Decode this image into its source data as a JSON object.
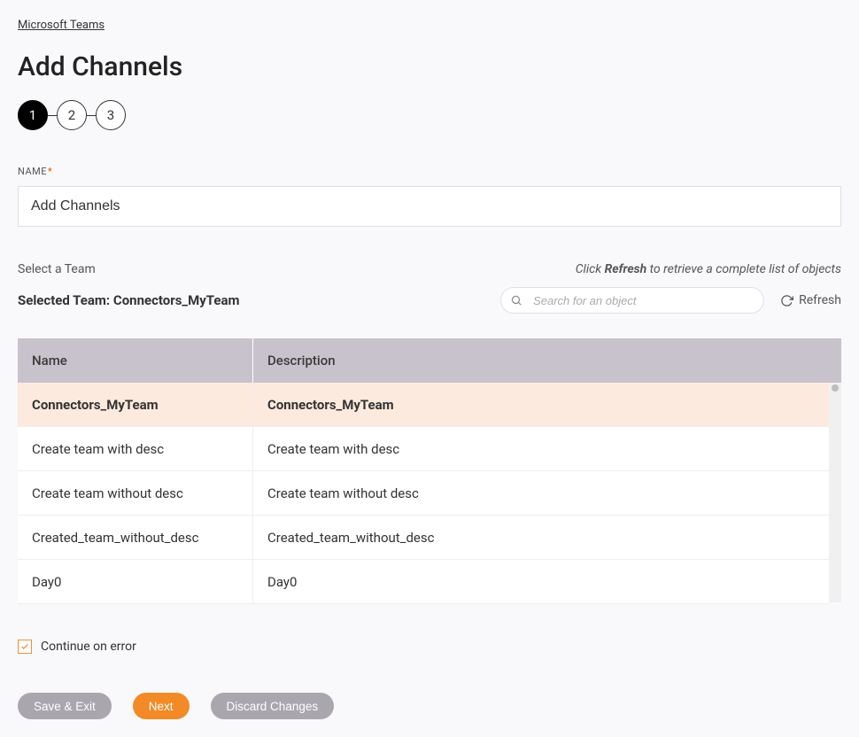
{
  "breadcrumb": {
    "label": "Microsoft Teams"
  },
  "page": {
    "title": "Add Channels"
  },
  "steps": {
    "labels": [
      "1",
      "2",
      "3"
    ],
    "active_index": 0
  },
  "name_field": {
    "label": "NAME",
    "required_mark": "*",
    "value": "Add Channels"
  },
  "select_team": {
    "label": "Select a Team",
    "hint_prefix": "Click ",
    "hint_bold": "Refresh",
    "hint_suffix": " to retrieve a complete list of objects",
    "selected_prefix": "Selected Team: ",
    "selected_value": "Connectors_MyTeam"
  },
  "search": {
    "placeholder": "Search for an object"
  },
  "refresh": {
    "label": "Refresh"
  },
  "table": {
    "headers": {
      "name": "Name",
      "desc": "Description"
    },
    "rows": [
      {
        "name": "Connectors_MyTeam",
        "desc": "Connectors_MyTeam",
        "selected": true
      },
      {
        "name": "Create team with desc",
        "desc": "Create team with desc",
        "selected": false
      },
      {
        "name": "Create team without desc",
        "desc": "Create team without desc",
        "selected": false
      },
      {
        "name": "Created_team_without_desc",
        "desc": "Created_team_without_desc",
        "selected": false
      },
      {
        "name": "Day0",
        "desc": "Day0",
        "selected": false
      }
    ]
  },
  "continue": {
    "label": "Continue on error",
    "checked": true
  },
  "buttons": {
    "save_exit": "Save & Exit",
    "next": "Next",
    "discard": "Discard Changes"
  }
}
